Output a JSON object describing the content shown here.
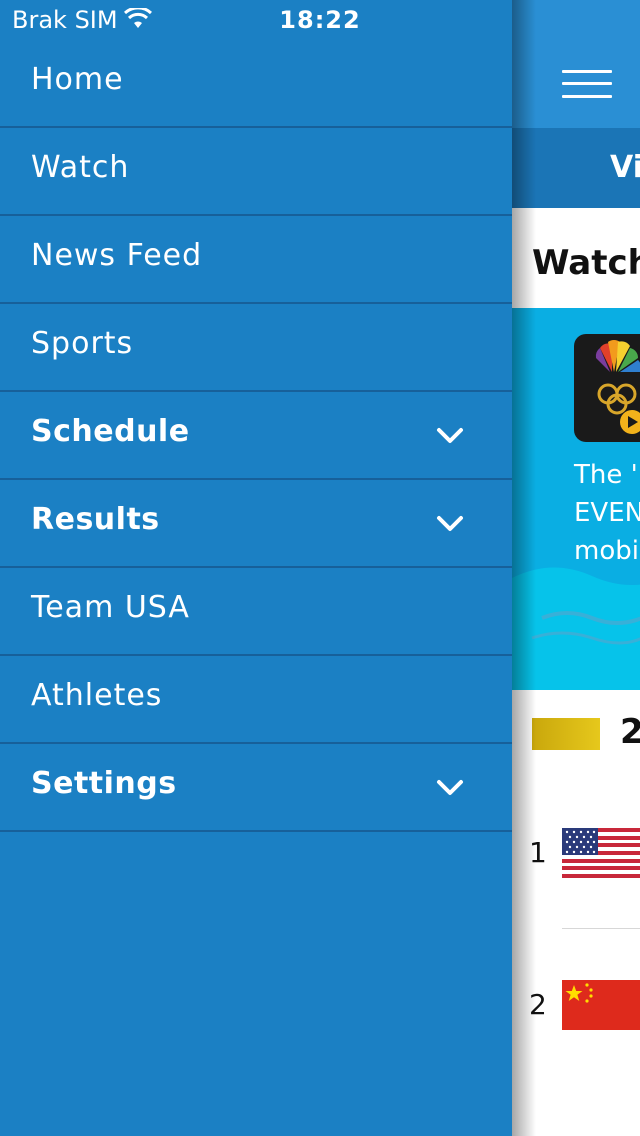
{
  "status_bar": {
    "carrier": "Brak SIM",
    "time": "18:22"
  },
  "drawer": {
    "items": [
      {
        "label": "Home",
        "bold": false,
        "expandable": false
      },
      {
        "label": "Watch",
        "bold": false,
        "expandable": false
      },
      {
        "label": "News Feed",
        "bold": false,
        "expandable": false
      },
      {
        "label": "Sports",
        "bold": false,
        "expandable": false
      },
      {
        "label": "Schedule",
        "bold": true,
        "expandable": true
      },
      {
        "label": "Results",
        "bold": true,
        "expandable": true
      },
      {
        "label": "Team USA",
        "bold": false,
        "expandable": false
      },
      {
        "label": "Athletes",
        "bold": false,
        "expandable": false
      },
      {
        "label": "Settings",
        "bold": true,
        "expandable": true
      }
    ]
  },
  "main": {
    "subbar_text": "Vi",
    "watch_heading": "Watch",
    "promo_lines": [
      "The 'N",
      "EVENT",
      "mobil"
    ],
    "medal_heading_fragment": "2",
    "ranks": [
      "1",
      "2"
    ]
  },
  "colors": {
    "drawer_bg": "#1b80c4",
    "divider": "#17609a",
    "topbar": "#2a8fd4",
    "promo": "#0aaee3",
    "gold": "#d4b516"
  }
}
